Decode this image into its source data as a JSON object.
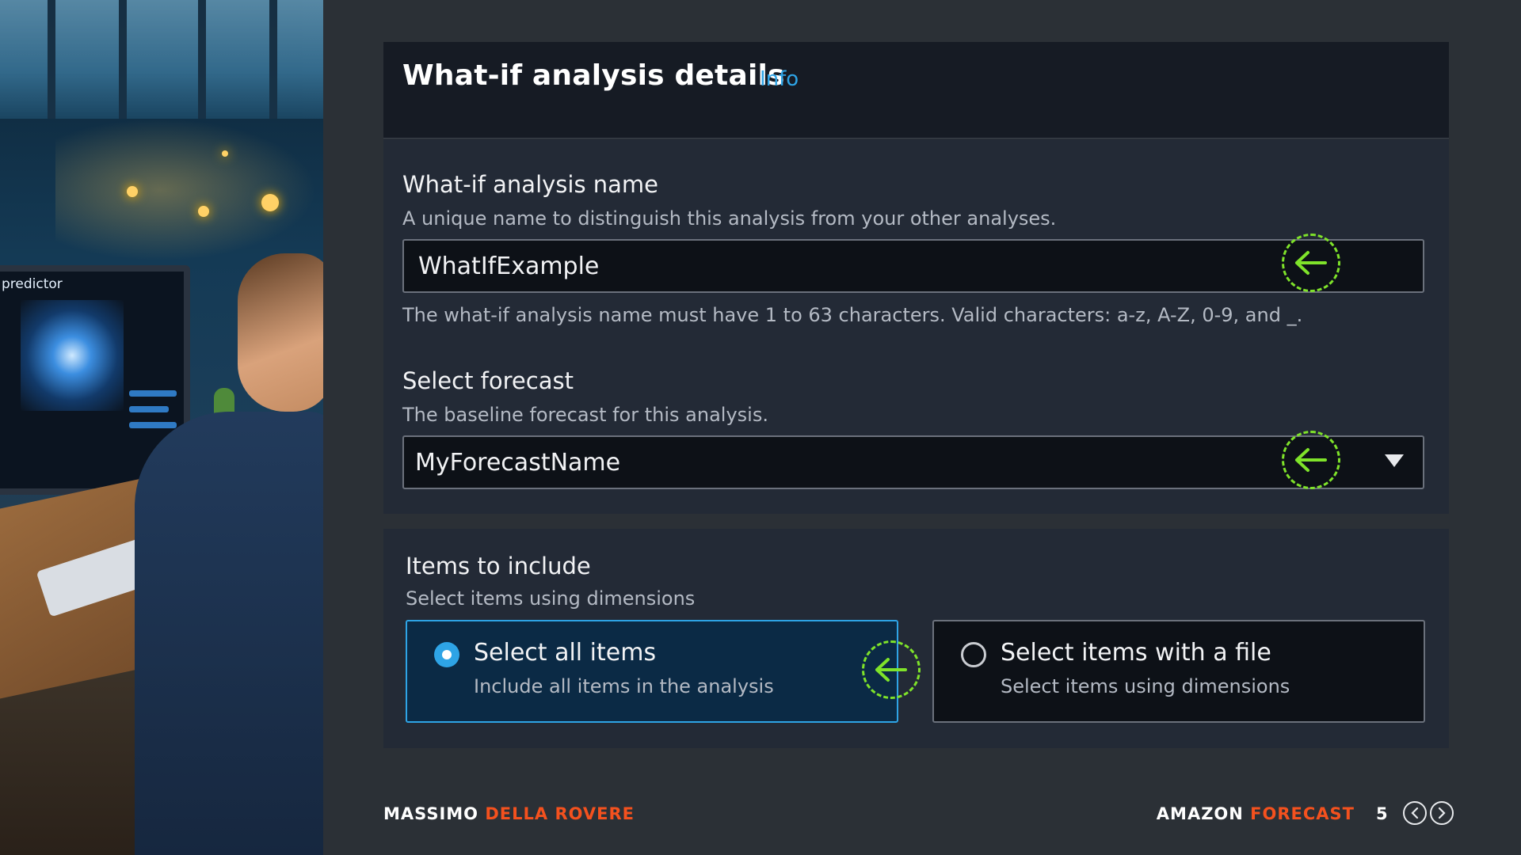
{
  "header": {
    "title": "What-if analysis details",
    "info_link": "Info"
  },
  "name_field": {
    "label": "What-if analysis name",
    "description": "A unique name to distinguish this analysis from your other analyses.",
    "value": "WhatIfExample",
    "hint": "The what-if analysis name must have 1 to 63 characters. Valid characters: a-z, A-Z, 0-9, and _."
  },
  "forecast_field": {
    "label": "Select forecast",
    "description": "The baseline forecast for this analysis.",
    "selected": "MyForecastName"
  },
  "items_section": {
    "label": "Items to include",
    "description": "Select items using dimensions",
    "options": [
      {
        "label": "Select all items",
        "description": "Include all items in the analysis",
        "selected": true
      },
      {
        "label": "Select items with a file",
        "description": "Select items using dimensions",
        "selected": false
      }
    ]
  },
  "illustration": {
    "screen_label": "predictor"
  },
  "footer": {
    "author_first": "MASSIMO",
    "author_last": "DELLA ROVERE",
    "product_first": "AMAZON",
    "product_last": "FORECAST",
    "page": "5"
  },
  "colors": {
    "accent": "#2ea4e6",
    "callout": "#7fe32a",
    "footer_highlight": "#f4511e",
    "background": "#2b3036"
  },
  "icons": {
    "callout": "arrow-left-icon",
    "dropdown": "caret-down-icon",
    "prev": "chevron-left-icon",
    "next": "chevron-right-icon"
  }
}
